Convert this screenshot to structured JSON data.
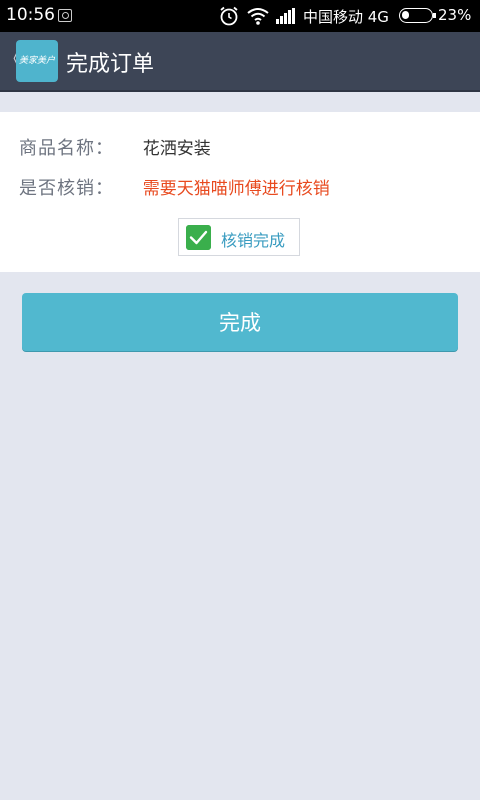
{
  "status_bar": {
    "time": "10:56",
    "carrier": "中国移动 4G",
    "battery": "23%",
    "icons": [
      "notification-icon",
      "alarm-icon",
      "wifi-icon",
      "signal-icon",
      "battery-icon"
    ]
  },
  "header": {
    "title": "完成订单",
    "logo_text": "美家美户",
    "back_glyph": "《"
  },
  "order": {
    "product_label": "商品名称：",
    "product_value": "花洒安装",
    "verify_label": "是否核销：",
    "verify_value": "需要天猫喵师傅进行核销",
    "checkbox_label": "核销完成",
    "checkbox_checked": true
  },
  "actions": {
    "done_label": "完成"
  },
  "colors": {
    "accent": "#51b8cf",
    "header_bg": "#3d4556",
    "alert": "#e84a1f",
    "check": "#3aaf4c",
    "page_bg": "#e3e6ef"
  }
}
